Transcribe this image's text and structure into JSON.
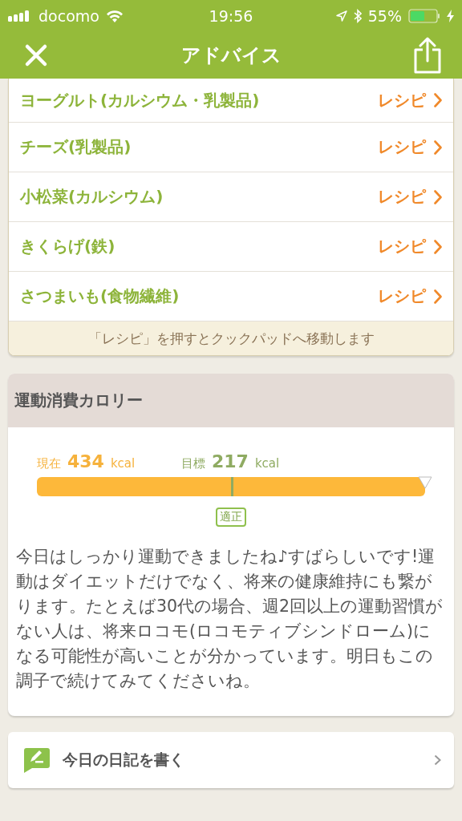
{
  "status_bar": {
    "carrier": "docomo",
    "time": "19:56",
    "battery": "55%"
  },
  "nav": {
    "title": "アドバイス"
  },
  "foods": [
    {
      "name": "ヨーグルト(カルシウム・乳製品)",
      "link": "レシピ"
    },
    {
      "name": "チーズ(乳製品)",
      "link": "レシピ"
    },
    {
      "name": "小松菜(カルシウム)",
      "link": "レシピ"
    },
    {
      "name": "きくらげ(鉄)",
      "link": "レシピ"
    },
    {
      "name": "さつまいも(食物繊維)",
      "link": "レシピ"
    }
  ],
  "foods_note": "「レシピ」を押すとクックパッドへ移動します",
  "calorie": {
    "title": "運動消費カロリー",
    "current_label": "現在",
    "current_value": "434",
    "current_unit": "kcal",
    "target_label": "目標",
    "target_value": "217",
    "target_unit": "kcal",
    "status": "適正",
    "message": "今日はしっかり運動できましたね♪すばらしいです!運動はダイエットだけでなく、将来の健康維持にも繋がります。たとえば30代の場合、週2回以上の運動習慣がない人は、将来ロコモ(ロコモティブシンドローム)になる可能性が高いことが分かっています。明日もこの調子で続けてみてくださいね。"
  },
  "diary": {
    "label": "今日の日記を書く"
  }
}
